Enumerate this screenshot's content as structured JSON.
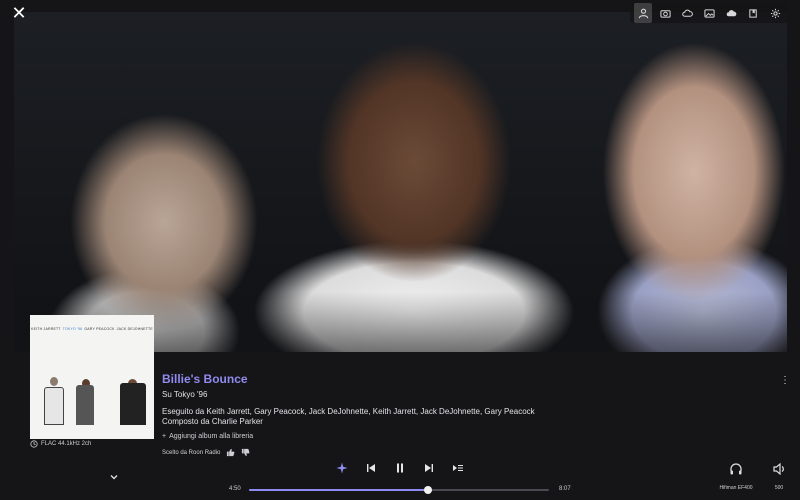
{
  "colors": {
    "accent": "#8f8bf0",
    "background": "#151517",
    "text": "#e8e8ea"
  },
  "toolbar": {
    "items": [
      {
        "icon": "person-icon",
        "active": true
      },
      {
        "icon": "camera-icon",
        "active": false
      },
      {
        "icon": "cloud-icon",
        "active": false
      },
      {
        "icon": "photo-icon",
        "active": false
      },
      {
        "icon": "cloud-alt-icon",
        "active": false
      },
      {
        "icon": "book-icon",
        "active": false
      },
      {
        "icon": "gear-icon",
        "active": false
      }
    ]
  },
  "cover": {
    "names": [
      "KEITH JARRETT",
      "TOKYO '96",
      "GARY PEACOCK",
      "JACK DEJOHNETTE"
    ]
  },
  "format": {
    "label": "FLAC 44.1kHz 2ch"
  },
  "track": {
    "title": "Billie's Bounce",
    "album_prefix": "Su",
    "album": "Tokyo '96",
    "performed_prefix": "Eseguito da",
    "performers": "Keith Jarrett, Gary Peacock, Jack DeJohnette, Keith Jarrett, Jack DeJohnette, Gary Peacock",
    "composed_prefix": "Composto da",
    "composer": "Charlie Parker",
    "add_to_library": "Aggiungi album alla libreria",
    "radio_label": "Scelto da Roon Radio"
  },
  "playback": {
    "elapsed": "4:50",
    "total": "8:07",
    "progress": 0.5955
  },
  "device": {
    "name": "Hifiman EF400"
  },
  "volume": {
    "level": "500"
  }
}
